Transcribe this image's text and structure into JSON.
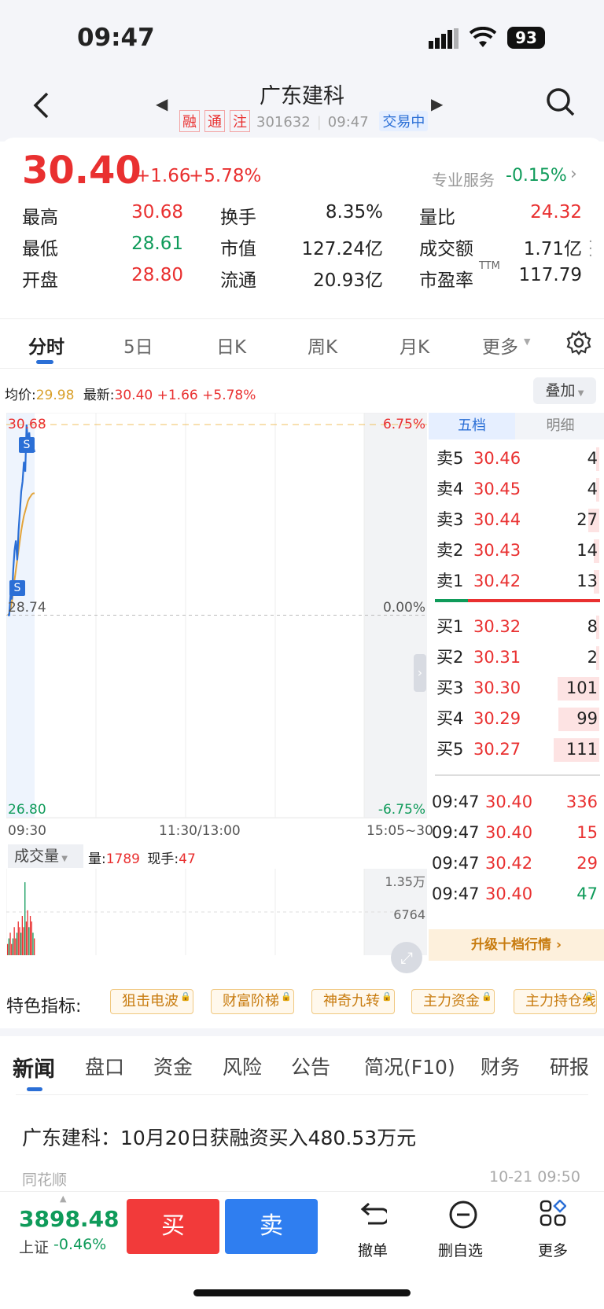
{
  "status": {
    "time": "09:47",
    "battery": "93"
  },
  "header": {
    "title": "广东建科",
    "tags": [
      "融",
      "通",
      "注"
    ],
    "code": "301632",
    "time": "09:47",
    "state": "交易中"
  },
  "quote": {
    "price": "30.40",
    "change": "+1.66",
    "pct": "+5.78%",
    "service_label": "专业服务",
    "service_value": "-0.15%",
    "rows": [
      [
        {
          "k": "最高",
          "v": "30.68",
          "c": "red"
        },
        {
          "k": "换手",
          "v": "8.35%",
          "c": "dark"
        },
        {
          "k": "量比",
          "v": "24.32",
          "c": "red"
        }
      ],
      [
        {
          "k": "最低",
          "v": "28.61",
          "c": "green"
        },
        {
          "k": "市值",
          "v": "127.24亿",
          "c": "dark"
        },
        {
          "k": "成交额",
          "v": "1.71亿",
          "c": "dark"
        }
      ],
      [
        {
          "k": "开盘",
          "v": "28.80",
          "c": "red"
        },
        {
          "k": "流通",
          "v": "20.93亿",
          "c": "dark"
        },
        {
          "k": "市盈率",
          "sup": "TTM",
          "v": "117.79",
          "c": "dark"
        }
      ]
    ]
  },
  "tabs": [
    "分时",
    "5日",
    "日K",
    "周K",
    "月K",
    "更多"
  ],
  "chart": {
    "avg_label": "均价:",
    "avg": "29.98",
    "latest_label": "最新:",
    "latest": "30.40",
    "change": "+1.66",
    "pct": "+5.78%",
    "overlay": "叠加",
    "y_top": "30.68",
    "y_mid": "28.74",
    "y_bot": "26.80",
    "p_top": "6.75%",
    "p_mid": "0.00%",
    "p_bot": "-6.75%",
    "x_start": "09:30",
    "x_mid": "11:30/13:00",
    "x_end": "15:05~30",
    "vol_label": "成交量",
    "vol_key": "量:",
    "vol": "1789",
    "hand_key": "现手:",
    "hand": "47",
    "vol_max": "1.35万",
    "vol_mid": "6764",
    "marker": "S",
    "price_series": [
      28.74,
      28.74,
      28.95,
      28.9,
      29.2,
      29.4,
      29.5,
      29.3,
      29.6,
      29.8,
      30.0,
      30.1,
      30.3,
      30.2,
      30.68,
      30.5,
      30.6,
      30.4,
      30.55,
      30.45,
      30.4
    ],
    "avg_series": [
      28.74,
      28.76,
      28.8,
      28.88,
      28.98,
      29.1,
      29.2,
      29.3,
      29.4,
      29.5,
      29.6,
      29.68,
      29.75,
      29.8,
      29.85,
      29.9,
      29.93,
      29.95,
      29.97,
      29.98,
      29.98
    ],
    "vol_bars": [
      2,
      3,
      4,
      2,
      3,
      5,
      3,
      4,
      6,
      5,
      4,
      7,
      5,
      13,
      6,
      8,
      5,
      7,
      6,
      4,
      3
    ]
  },
  "book": {
    "tab1": "五档",
    "tab2": "明细",
    "sells": [
      {
        "k": "卖5",
        "p": "30.46",
        "v": "4"
      },
      {
        "k": "卖4",
        "p": "30.45",
        "v": "4"
      },
      {
        "k": "卖3",
        "p": "30.44",
        "v": "27"
      },
      {
        "k": "卖2",
        "p": "30.43",
        "v": "14"
      },
      {
        "k": "卖1",
        "p": "30.42",
        "v": "13"
      }
    ],
    "buys": [
      {
        "k": "买1",
        "p": "30.32",
        "v": "8"
      },
      {
        "k": "买2",
        "p": "30.31",
        "v": "2"
      },
      {
        "k": "买3",
        "p": "30.30",
        "v": "101"
      },
      {
        "k": "买4",
        "p": "30.29",
        "v": "99"
      },
      {
        "k": "买5",
        "p": "30.27",
        "v": "111"
      }
    ],
    "ticks": [
      {
        "t": "09:47",
        "p": "30.40",
        "v": "336",
        "c": "red"
      },
      {
        "t": "09:47",
        "p": "30.40",
        "v": "15",
        "c": "red"
      },
      {
        "t": "09:47",
        "p": "30.42",
        "v": "29",
        "c": "red"
      },
      {
        "t": "09:47",
        "p": "30.40",
        "v": "47",
        "c": "green"
      }
    ],
    "upgrade": "升级十档行情"
  },
  "features": {
    "label": "特色指标:",
    "items": [
      "狙击电波",
      "财富阶梯",
      "神奇九转",
      "主力资金",
      "主力持仓线"
    ]
  },
  "news_tabs": [
    "新闻",
    "盘口",
    "资金",
    "风险",
    "公告",
    "简况(F10)",
    "财务",
    "研报"
  ],
  "news": {
    "title": "广东建科：10月20日获融资买入480.53万元",
    "source": "同花顺",
    "time": "10-21 09:50"
  },
  "bottom": {
    "index": "3898.48",
    "index_name": "上证",
    "index_pct": "-0.46%",
    "buy": "买",
    "sell": "卖",
    "cancel": "撤单",
    "remove": "删自选",
    "more": "更多"
  },
  "colors": {
    "up": "#e93030",
    "down": "#0f9b5a",
    "accent": "#2b6fd6"
  }
}
